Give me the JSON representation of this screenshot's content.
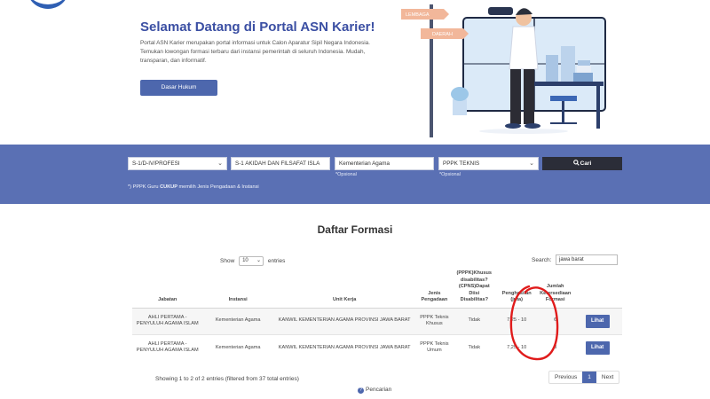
{
  "hero": {
    "title": "Selamat Datang di Portal ASN Karier!",
    "description": "Portal ASN Karier merupakan portal informasi untuk Calon Aparatur Sipil Negara Indonesia. Temukan lowongan formasi terbaru dari instansi pemerintah di seluruh Indonesia. Mudah, transparan, dan informatif.",
    "button_label": "Dasar Hukum",
    "sign_top": "LEMBAGA",
    "sign_bottom": "DAERAH"
  },
  "filters": {
    "pendidikan": "S-1/D-IV/PROFESI",
    "jurusan": "S-1 AKIDAH DAN FILSAFAT ISLA",
    "instansi": "Kementerian Agama",
    "jenis": "PPPK TEKNIS",
    "cari_label": "Cari",
    "opsional_1": "*Opsional",
    "opsional_2": "*Opsional",
    "note_prefix": "*) PPPK Guru ",
    "note_bold": "CUKUP",
    "note_suffix": " memilih Jenis Pengadaan & Instansi"
  },
  "list": {
    "title": "Daftar Formasi",
    "show_label": "Show",
    "page_length": "10",
    "entries_label": "entries",
    "search_label": "Search:",
    "search_value": "jawa barat",
    "columns": {
      "jabatan": "Jabatan",
      "instansi": "Instansi",
      "unit_kerja": "Unit Kerja",
      "jenis_pengadaan": "Jenis Pengadaan",
      "disabilitas": "(PPPK)Khusus disabilitas? (CPNS)Dapat Diisi Disabilitas?",
      "penghasilan": "Penghasilan (juta)",
      "jumlah": "Jumlah Ketersediaan Formasi"
    },
    "rows": [
      {
        "jabatan": "AHLI PERTAMA - PENYULUH AGAMA ISLAM",
        "instansi": "Kementerian Agama",
        "unit_kerja": "KANWIL KEMENTERIAN AGAMA PROVINSI JAWA BARAT",
        "jenis_pengadaan": "PPPK Teknis Khusus",
        "disabilitas": "Tidak",
        "penghasilan": "7,25 - 10",
        "jumlah": "6",
        "action": "Lihat"
      },
      {
        "jabatan": "AHLI PERTAMA - PENYULUH AGAMA ISLAM",
        "instansi": "Kementerian Agama",
        "unit_kerja": "KANWIL KEMENTERIAN AGAMA PROVINSI JAWA BARAT",
        "jenis_pengadaan": "PPPK Teknis Umum",
        "disabilitas": "Tidak",
        "penghasilan": "7,25 - 10",
        "jumlah": "3",
        "action": "Lihat"
      }
    ],
    "info": "Showing 1 to 2 of 2 entries (filtered from 37 total entries)",
    "pager": {
      "previous": "Previous",
      "current": "1",
      "next": "Next"
    },
    "pencarian_label": "Pencarian"
  },
  "colors": {
    "brand_blue": "#4d67ad",
    "band_blue": "#5a70b4",
    "annotation_red": "#e01b1b"
  }
}
